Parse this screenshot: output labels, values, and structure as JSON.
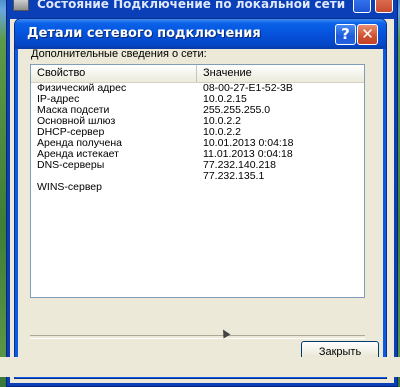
{
  "parent_window": {
    "title": "Состояние Подключение по локальной сети"
  },
  "dialog": {
    "title": "Детали сетевого подключения",
    "help_label": "?",
    "close_label": "✕",
    "description": "Дополнительные сведения о сети:",
    "columns": [
      "Свойство",
      "Значение"
    ],
    "rows": [
      {
        "property": "Физический адрес",
        "value": "08-00-27-E1-52-3B"
      },
      {
        "property": "IP-адрес",
        "value": "10.0.2.15"
      },
      {
        "property": "Маска подсети",
        "value": "255.255.255.0"
      },
      {
        "property": "Основной шлюз",
        "value": "10.0.2.2"
      },
      {
        "property": "DHCP-сервер",
        "value": "10.0.2.2"
      },
      {
        "property": "Аренда получена",
        "value": "10.01.2013 0:04:18"
      },
      {
        "property": "Аренда истекает",
        "value": "11.01.2013 0:04:18"
      },
      {
        "property": "DNS-серверы",
        "value": "77.232.140.218"
      },
      {
        "property": "",
        "value": "77.232.135.1"
      },
      {
        "property": "WINS-сервер",
        "value": ""
      }
    ],
    "close_button_label": "Закрыть"
  },
  "colors": {
    "titlebar": "#0552dc",
    "dialog_bg": "#ece9d8",
    "close_btn": "#d0512f",
    "help_btn": "#1c5bd9"
  }
}
